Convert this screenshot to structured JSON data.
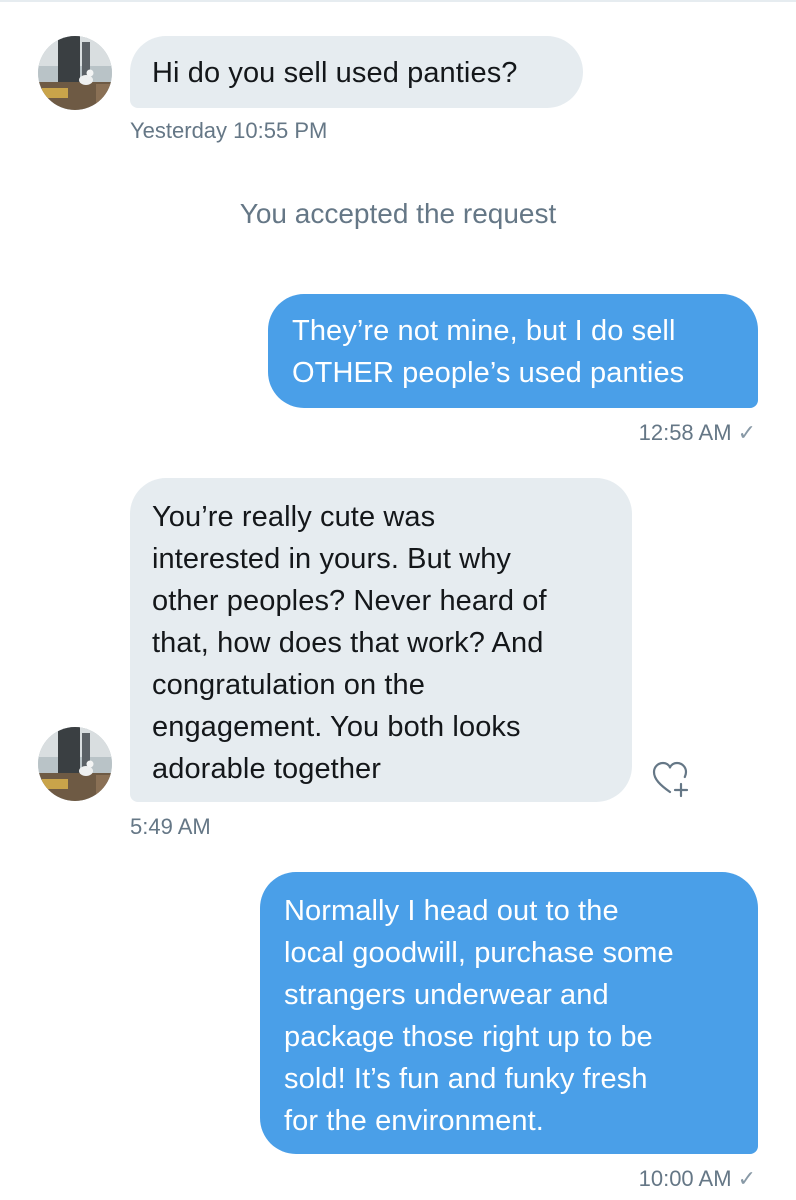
{
  "messages": [
    {
      "direction": "incoming",
      "text": "Hi do you sell used panties?",
      "timestamp": "Yesterday 10:55 PM"
    },
    {
      "direction": "system",
      "text": "You accepted the request"
    },
    {
      "direction": "outgoing",
      "text": "They’re not mine, but I do sell\nOTHER people’s used panties",
      "timestamp": "12:58 AM",
      "status_icon": "checkmark-icon"
    },
    {
      "direction": "incoming",
      "text": "You’re really cute was\ninterested in yours. But why\nother peoples? Never heard of\nthat, how does that work? And\ncongratulation on the\nengagement. You both looks\nadorable together",
      "timestamp": "5:49 AM",
      "action_icon": "heart-plus-icon"
    },
    {
      "direction": "outgoing",
      "text": "Normally I head out to the\nlocal goodwill, purchase some\nstrangers underwear and\npackage those right up to be\nsold! It’s fun and funky fresh\nfor the environment.",
      "timestamp": "10:00 AM",
      "status_icon": "checkmark-icon"
    }
  ],
  "check_glyph": "✓",
  "colors": {
    "incoming_bubble": "#e6ecf0",
    "outgoing_bubble": "#4a9fe8",
    "meta_text": "#657786"
  }
}
